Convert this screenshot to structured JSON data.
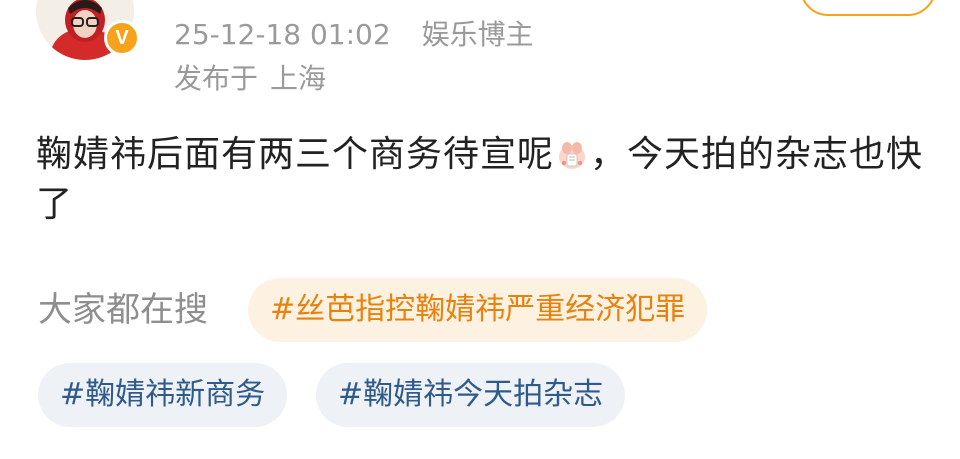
{
  "post": {
    "timestamp": "25-12-18 01:02",
    "author_badge": "娱乐博主",
    "location_prefix": "发布于",
    "location": "上海",
    "verified_mark": "V",
    "content_part1": "鞠婧祎后面有两三个商务待宣呢",
    "content_part2": "，今天拍的杂志也快了",
    "emoji_icon": "pray-emoji-icon"
  },
  "search": {
    "label": "大家都在搜",
    "hot_tag": "#丝芭指控鞠婧祎严重经济犯罪",
    "tags": [
      "#鞠婧祎新商务",
      "#鞠婧祎今天拍杂志"
    ]
  },
  "colors": {
    "accent": "#f7a21b",
    "hot_tag_bg": "#fdf1e1",
    "hot_tag_text": "#e8820f",
    "tag_bg": "#eef2f6",
    "tag_text": "#2f5a8a",
    "meta_text": "#9a9a9a"
  }
}
